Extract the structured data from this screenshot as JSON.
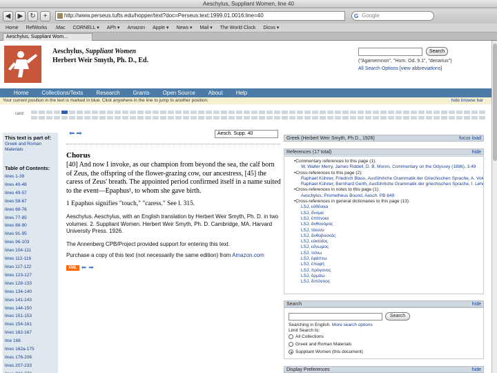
{
  "browser": {
    "window_title": "Aeschylus, Suppliant Women, line 40",
    "url": "http://www.perseus.tufts.edu/hopper/text?doc=Perseus:text:1999.01.0016:line=40",
    "search_engine": "Google",
    "bookmarks": [
      "Home",
      "RefWorks",
      ".Mac",
      "CORNELL ▾",
      "APh ▾",
      "Amazon",
      "Apple ▾",
      "News ▾",
      "Mail ▾",
      "The World Clock",
      "Dicos ▾"
    ],
    "tab_title": "Aeschylus, Suppliant Wom..."
  },
  "header": {
    "work_title_author": "Aeschylus,",
    "work_title_name": "Suppliant Women",
    "editor": "Herbert Weir Smyth, Ph. D., Ed.",
    "search_button": "Search",
    "search_examples": "(\"Agamemnon\", \"Hom. Od. 9.1\", \"denarius\")",
    "search_links": "All Search Options [view abbreviations]"
  },
  "nav": {
    "items": [
      "Home",
      "Collections/Texts",
      "Research",
      "Grants",
      "Open Source",
      "About",
      "Help"
    ],
    "position_notice": "Your current position in the text is marked in blue. Click anywhere in the line to jump to another position:",
    "hide_browse": "hide browse bar",
    "cards_label": "card:"
  },
  "sidebar": {
    "part_of_heading": "This text is part of:",
    "part_of_link": "Greek and Roman Materials",
    "toc_heading": "Table of Contents:",
    "toc": [
      "lines 1-39",
      "lines 40-48",
      "lines 49-57",
      "lines 58-67",
      "lines 68-76",
      "lines 77-85",
      "lines 86-90",
      "lines 91-95",
      "lines 96-103",
      "lines 104-111",
      "lines 112-116",
      "lines 117-122",
      "lines 123-127",
      "lines 128-133",
      "lines 134-140",
      "lines 141-143",
      "lines 144-150",
      "lines 151-153",
      "lines 154-161",
      "lines 162-167",
      "line 168",
      "lines 162a-175",
      "lines 176-206",
      "lines 207-233",
      "lines 234-273"
    ]
  },
  "main": {
    "location_value": "Aesch. Supp. 40",
    "speaker": "Chorus",
    "passage": "[40] And now I invoke, as our champion from beyond the sea, the calf born of Zeus, the offspring of the flower-grazing cow, our ancestress, [45] the caress of Zeus' breath. The appointed period confirmed itself in a name suited to the event—Epaphus¹, to whom she gave birth.",
    "footnote": "1 Epaphus signifies \"touch,\" \"caress.\" See l. 315.",
    "citation": "Aeschylus. Aeschylus, with an English translation by Herbert Weir Smyth, Ph. D. in two volumes. 2. Suppliant Women. Herbert Weir Smyth, Ph. D. Cambridge, MA. Harvard University Press. 1926.",
    "support": "The Annenberg CPB/Project provided support for entering this text.",
    "purchase": "Purchase a copy of this text (not necessarily the same edition) from",
    "purchase_link": "Amazon.com",
    "xml_label": "XML"
  },
  "right_panel": {
    "greek_heading": "Greek (Herbert Weir Smyth, Ph.D., 1926)",
    "focus_load": "focus load",
    "refs_heading": "References (17 total)",
    "hide": "hide",
    "refs": [
      {
        "level": 1,
        "text": "Commentary references to this page (1):"
      },
      {
        "level": 2,
        "text": "W. Walter Merry, James Riddell, D. B. Monro, Commentary on the Odyssey (1886), 3.49"
      },
      {
        "level": 1,
        "text": "Cross-references to this page (2):"
      },
      {
        "level": 2,
        "text": "Raphael Kühner, Friedrich Blass, Ausführliche Grammatik der Griechischen Sprache, A. Vokale"
      },
      {
        "level": 2,
        "text": "Raphael Kühner, Bernhard Gerth, Ausführliche Grammatik der griechischen Sprache, I. Lehre von der Präpositionen."
      },
      {
        "level": 1,
        "text": "Cross-references in notes to this page (1):"
      },
      {
        "level": 2,
        "text": "Aeschylus, Prometheus Bound, Aesch. PB 849"
      },
      {
        "level": 1,
        "text": "Cross-references in general dictionaries to this page (13):"
      },
      {
        "level": 2,
        "text": "LSJ, εὐθένεια"
      },
      {
        "level": 2,
        "text": "LSJ, ὄνομα"
      },
      {
        "level": 2,
        "text": "LSJ, ἐπίπνοια"
      },
      {
        "level": 2,
        "text": "LSJ, ἀνθονόμος"
      },
      {
        "level": 2,
        "text": "LSJ, τέκνον"
      },
      {
        "level": 2,
        "text": "LSJ, ἀνθοβοσκός"
      },
      {
        "level": 2,
        "text": "LSJ, εὐκταίος"
      },
      {
        "level": 2,
        "text": "LSJ, εὔνωμος"
      },
      {
        "level": 2,
        "text": "LSJ, τείνω"
      },
      {
        "level": 2,
        "text": "LSJ, ἐφάπτω"
      },
      {
        "level": 2,
        "text": "LSJ, ἐπαφή"
      },
      {
        "level": 2,
        "text": "LSJ, πρόγονος"
      },
      {
        "level": 2,
        "text": "LSJ, ὁρμάω"
      },
      {
        "level": 2,
        "text": "LSJ, διπόντιος"
      }
    ],
    "search_heading": "Search",
    "search_button": "Search",
    "searching_in": "Searching in English.",
    "more_options": "More search options",
    "limit_label": "Limit Search to:",
    "radio_options": [
      "All Collections",
      "Greek and Roman Materials",
      "Suppliant Women (this document)"
    ],
    "display_heading": "Display Preferences"
  }
}
